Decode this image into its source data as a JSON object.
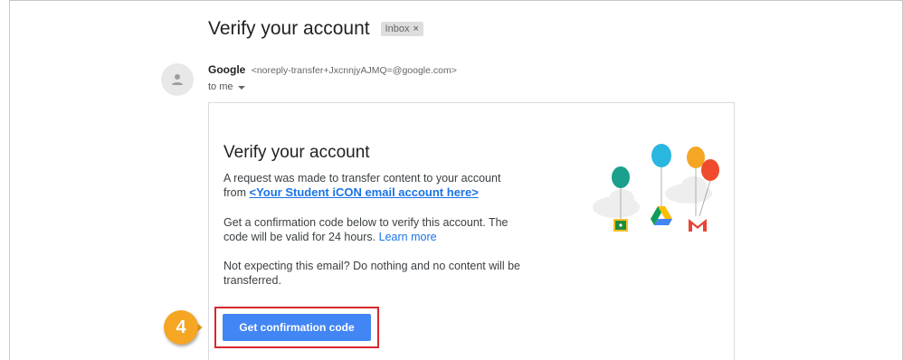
{
  "email": {
    "subject": "Verify your account",
    "label_badge": "Inbox",
    "label_close": "×",
    "sender_name": "Google",
    "sender_email": "<noreply-transfer+JxcnnjyAJMQ=@google.com>",
    "recipient": "to me"
  },
  "card": {
    "title": "Verify your account",
    "para1_text": "A request was made to transfer content to your account from",
    "para1_link": "<Your Student iCON email account here>",
    "para2_text": "Get a confirmation code below to verify this account. The code will be valid for 24 hours.",
    "para2_link": "Learn more",
    "para3_text": "Not expecting this email? Do nothing and no content will be transferred.",
    "button_label": "Get confirmation code"
  },
  "annotation": {
    "step_number": "4"
  },
  "colors": {
    "primary_blue": "#4285f4",
    "link_blue": "#1a73e8",
    "highlight_red": "#d9272e",
    "step_orange": "#f5a623"
  },
  "icons": [
    "person-icon",
    "classroom-icon",
    "drive-icon",
    "gmail-icon",
    "balloon-icon",
    "cloud-icon"
  ]
}
